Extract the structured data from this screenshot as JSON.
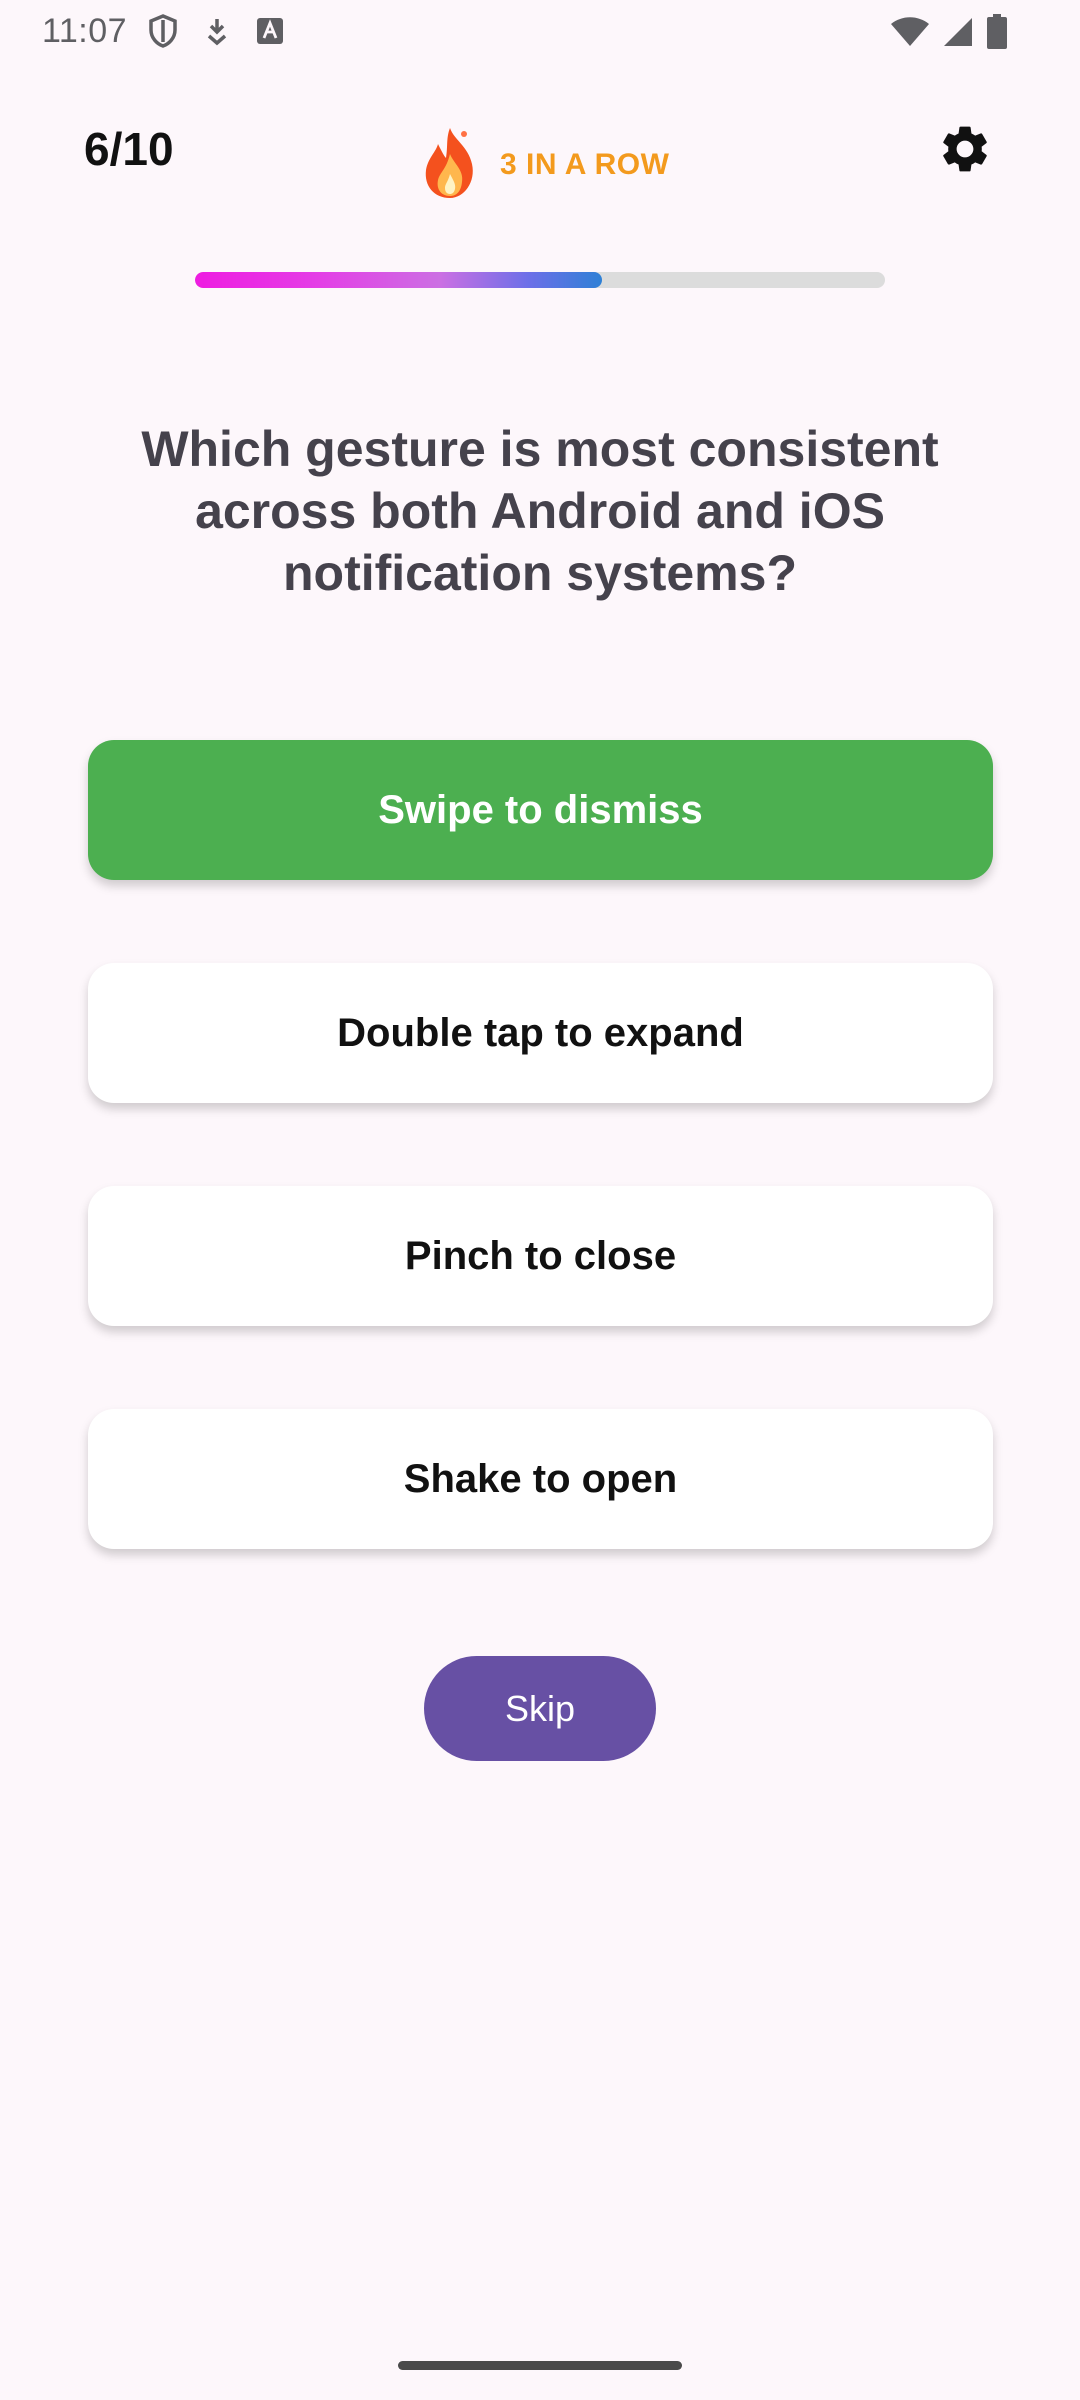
{
  "status_bar": {
    "time": "11:07",
    "left_icons": [
      "shield-icon",
      "download-icon",
      "keyboard-a-icon"
    ],
    "right_icons": [
      "wifi-icon",
      "signal-icon",
      "battery-icon"
    ]
  },
  "header": {
    "progress_text": "6/10",
    "streak_label": "3 IN A ROW",
    "streak_icon": "fire-icon",
    "settings_icon": "gear-icon"
  },
  "progress": {
    "fraction": 0.59
  },
  "question": {
    "text": "Which gesture is most consistent across both Android and iOS notification systems?"
  },
  "answers": [
    {
      "label": "Swipe to dismiss",
      "state": "correct"
    },
    {
      "label": "Double tap to expand",
      "state": "default"
    },
    {
      "label": "Pinch to close",
      "state": "default"
    },
    {
      "label": "Shake to open",
      "state": "default"
    }
  ],
  "skip_label": "Skip",
  "colors": {
    "background": "#fdf7fb",
    "correct": "#4caf50",
    "skip": "#6750a4",
    "streak": "#f39a1d"
  }
}
